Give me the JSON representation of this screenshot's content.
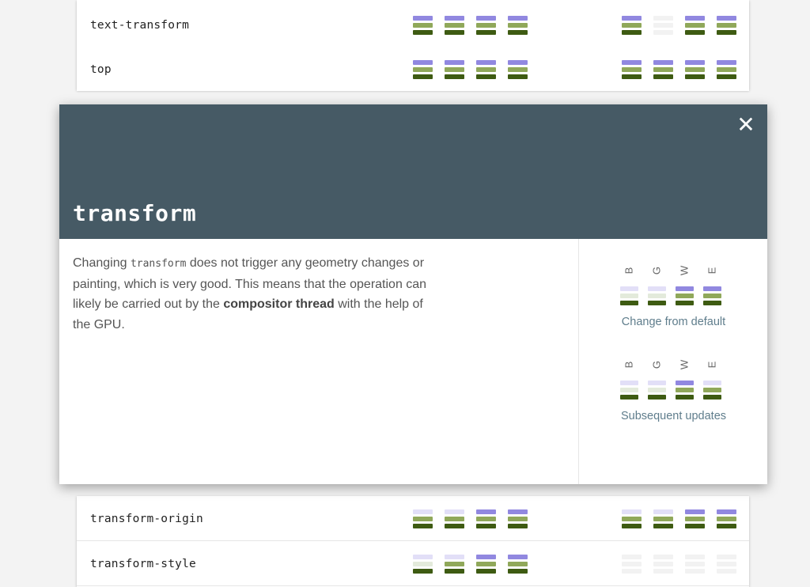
{
  "colors": {
    "purple": "#9188e0",
    "purple_light": "#e2dff7",
    "green": "#90a85a",
    "green_light": "#e3eadb",
    "dark": "#3e5b12",
    "empty": "#f2f2f2",
    "header": "#465a65",
    "caption": "#5f7d8c"
  },
  "rows_top": [
    {
      "name": "text-transform",
      "m1": [
        [
          "p",
          "g",
          "d"
        ],
        [
          "p",
          "g",
          "d"
        ],
        [
          "p",
          "g",
          "d"
        ],
        [
          "p",
          "g",
          "d"
        ]
      ],
      "m2": [
        [
          "p",
          "g",
          "d"
        ],
        [
          "e",
          "e",
          "e"
        ],
        [
          "p",
          "g",
          "d"
        ],
        [
          "p",
          "g",
          "d"
        ]
      ]
    },
    {
      "name": "top",
      "m1": [
        [
          "p",
          "g",
          "d"
        ],
        [
          "p",
          "g",
          "d"
        ],
        [
          "p",
          "g",
          "d"
        ],
        [
          "p",
          "g",
          "d"
        ]
      ],
      "m2": [
        [
          "p",
          "g",
          "d"
        ],
        [
          "p",
          "g",
          "d"
        ],
        [
          "p",
          "g",
          "d"
        ],
        [
          "p",
          "g",
          "d"
        ]
      ]
    }
  ],
  "rows_bottom": [
    {
      "name": "transform-origin",
      "m1": [
        [
          "pl",
          "g",
          "d"
        ],
        [
          "pl",
          "g",
          "d"
        ],
        [
          "p",
          "g",
          "d"
        ],
        [
          "p",
          "g",
          "d"
        ]
      ],
      "m2": [
        [
          "pl",
          "g",
          "d"
        ],
        [
          "pl",
          "g",
          "d"
        ],
        [
          "p",
          "g",
          "d"
        ],
        [
          "p",
          "g",
          "d"
        ]
      ]
    },
    {
      "name": "transform-style",
      "m1": [
        [
          "pl",
          "gl",
          "d"
        ],
        [
          "pl",
          "g",
          "d"
        ],
        [
          "p",
          "g",
          "d"
        ],
        [
          "p",
          "g",
          "d"
        ]
      ],
      "m2": [
        [
          "e",
          "e",
          "e"
        ],
        [
          "e",
          "e",
          "e"
        ],
        [
          "e",
          "e",
          "e"
        ],
        [
          "e",
          "e",
          "e"
        ]
      ]
    }
  ],
  "modal": {
    "title": "transform",
    "close_label": "✕",
    "body_before": "Changing ",
    "body_code": "transform",
    "body_middle": " does not trigger any geometry changes or painting, which is very good. This means that the operation can likely be carried out by the ",
    "body_bold": "compositor thread",
    "body_after": " with the help of the GPU.",
    "letters": [
      "B",
      "G",
      "W",
      "E"
    ],
    "change_from_default": {
      "caption": "Change from default",
      "meter": [
        [
          "pl",
          "gl",
          "d"
        ],
        [
          "pl",
          "gl",
          "d"
        ],
        [
          "p",
          "g",
          "d"
        ],
        [
          "p",
          "g",
          "d"
        ]
      ]
    },
    "subsequent_updates": {
      "caption": "Subsequent updates",
      "meter": [
        [
          "pl",
          "gl",
          "d"
        ],
        [
          "pl",
          "gl",
          "d"
        ],
        [
          "p",
          "g",
          "d"
        ],
        [
          "pl",
          "g",
          "d"
        ]
      ]
    }
  }
}
